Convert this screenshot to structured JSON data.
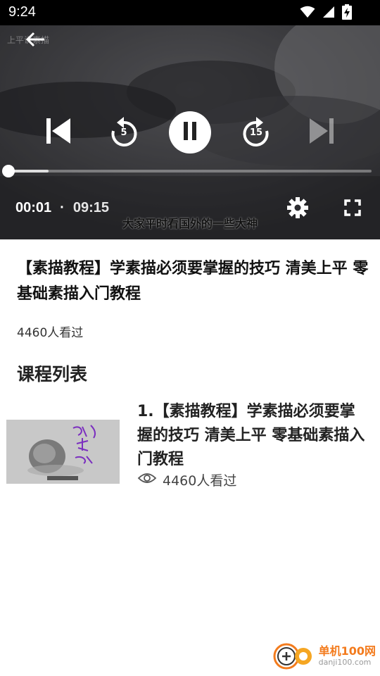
{
  "status_bar": {
    "time": "9:24"
  },
  "player": {
    "watermark": "上平说素描",
    "subtitle": "大家平时看国外的一些大神",
    "current_time": "00:01",
    "separator": "·",
    "total_time": "09:15",
    "progress_fraction": 0.0,
    "buffered_fraction": 0.11,
    "rewind_seconds": "5",
    "forward_seconds": "15"
  },
  "video": {
    "title": "【素描教程】学素描必须要掌握的技巧 清美上平 零基础素描入门教程",
    "views": "4460人看过"
  },
  "course_list": {
    "heading": "课程列表",
    "items": [
      {
        "title": "1.【素描教程】学素描必须要掌握的技巧 清美上平 零基础素描入门教程",
        "views": "4460人看过"
      }
    ]
  },
  "watermark_logo": {
    "cn": "单机100网",
    "en": "danji100.com"
  }
}
